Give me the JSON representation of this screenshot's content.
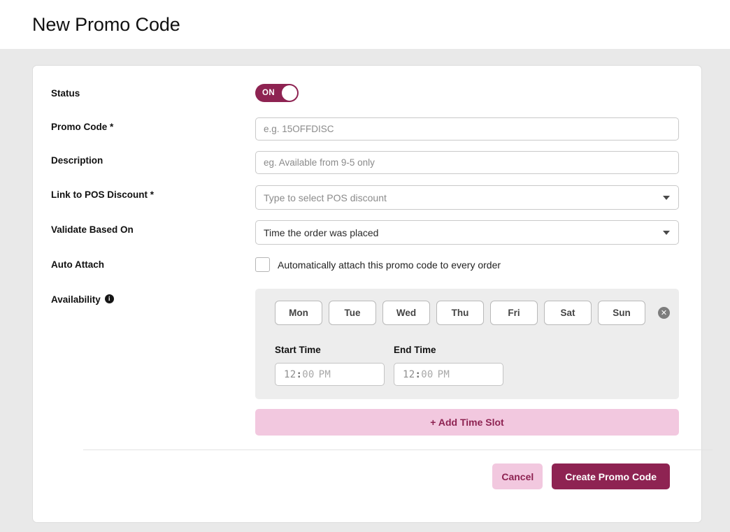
{
  "header": {
    "title": "New Promo Code"
  },
  "form": {
    "status": {
      "label": "Status",
      "toggle_state": "ON",
      "accent_color": "#8e2352"
    },
    "promo_code": {
      "label": "Promo Code *",
      "value": "",
      "placeholder": "e.g. 15OFFDISC"
    },
    "description": {
      "label": "Description",
      "value": "",
      "placeholder": "eg. Available from 9-5 only"
    },
    "link_pos_discount": {
      "label": "Link to POS Discount *",
      "selected": "Type to select POS discount",
      "is_placeholder": true,
      "caret_icon": "chevron-down-icon"
    },
    "validate_based_on": {
      "label": "Validate Based On",
      "selected": "Time the order was placed",
      "is_placeholder": false,
      "caret_icon": "chevron-down-icon"
    },
    "auto_attach": {
      "label": "Auto Attach",
      "checkbox_label": "Automatically attach this promo code to every order",
      "checked": false
    },
    "availability": {
      "label": "Availability",
      "info_icon": "info-icon",
      "days": [
        "Mon",
        "Tue",
        "Wed",
        "Thu",
        "Fri",
        "Sat",
        "Sun"
      ],
      "selected_days": [],
      "remove_icon": "circle-x-icon",
      "start_time": {
        "label": "Start Time",
        "value": "",
        "placeholder_hour": "12",
        "placeholder_sep": ":",
        "placeholder_minute": "00",
        "placeholder_meridiem": "PM"
      },
      "end_time": {
        "label": "End Time",
        "value": "",
        "placeholder_hour": "12",
        "placeholder_sep": ":",
        "placeholder_minute": "00",
        "placeholder_meridiem": "PM"
      },
      "add_time_slot_label": "+ Add Time Slot"
    }
  },
  "footer": {
    "cancel_label": "Cancel",
    "create_label": "Create Promo Code"
  }
}
